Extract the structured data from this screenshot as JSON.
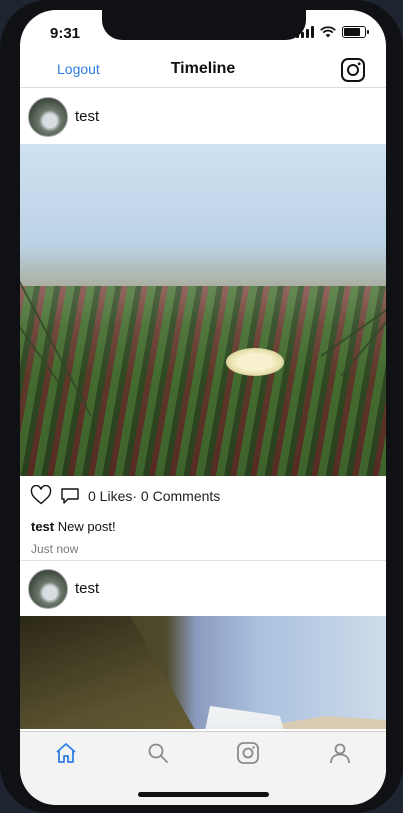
{
  "status_bar": {
    "time": "9:31",
    "battery_level": 0.8
  },
  "navbar": {
    "left_label": "Logout",
    "title": "Timeline",
    "right_icon": "instagram-icon"
  },
  "posts": [
    {
      "username": "test",
      "likes_text": "0 Likes",
      "comments_text": "0 Comments",
      "separator": "·",
      "caption_user": "test",
      "caption_text": "New post!",
      "timestamp": "Just now"
    },
    {
      "username": "test"
    }
  ],
  "tabbar": {
    "active_tab": "home",
    "active_color": "#2f7de1",
    "inactive_color": "#8a8a8a",
    "tabs": [
      "home-icon",
      "search-icon",
      "instagram-icon",
      "profile-icon"
    ]
  }
}
